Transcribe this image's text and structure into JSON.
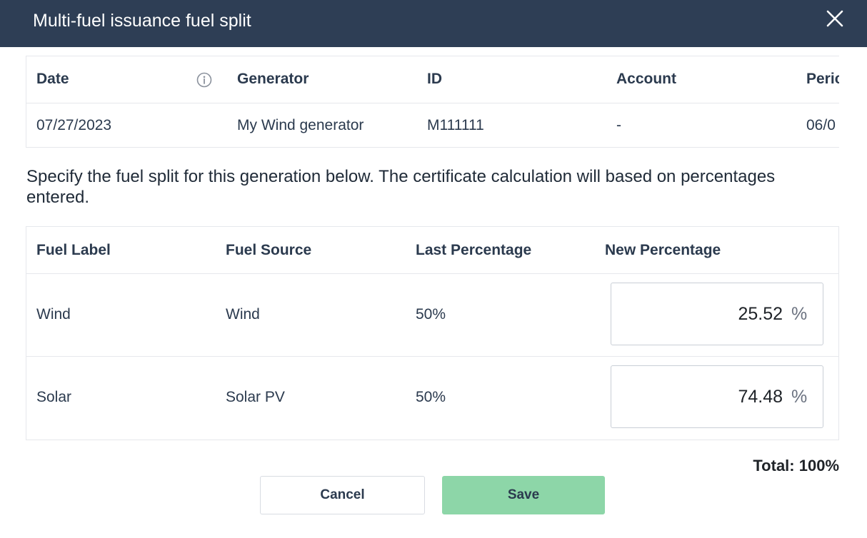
{
  "dialog": {
    "title": "Multi-fuel issuance fuel split",
    "close_icon": "close-icon"
  },
  "generation_table": {
    "headers": [
      "Date",
      "Generator",
      "ID",
      "Account",
      "Peric"
    ],
    "info_icon": "info-icon",
    "row": [
      "07/27/2023",
      "My Wind generator",
      "M111111",
      "-",
      "06/0"
    ]
  },
  "instructions": "Specify the fuel split for this generation below. The certificate calculation will based on percentages entered.",
  "fuel_table": {
    "headers": [
      "Fuel Label",
      "Fuel Source",
      "Last Percentage",
      "New Percentage"
    ],
    "rows": [
      {
        "label": "Wind",
        "source": "Wind",
        "last": "50%",
        "new_value": "25.52",
        "unit": "%"
      },
      {
        "label": "Solar",
        "source": "Solar PV",
        "last": "50%",
        "new_value": "74.48",
        "unit": "%"
      }
    ]
  },
  "total": "Total: 100%",
  "buttons": {
    "cancel": "Cancel",
    "save": "Save"
  },
  "colors": {
    "header_bg": "#2e3e55",
    "save_bg": "#8dd6a8",
    "text": "#2b3a4e"
  }
}
